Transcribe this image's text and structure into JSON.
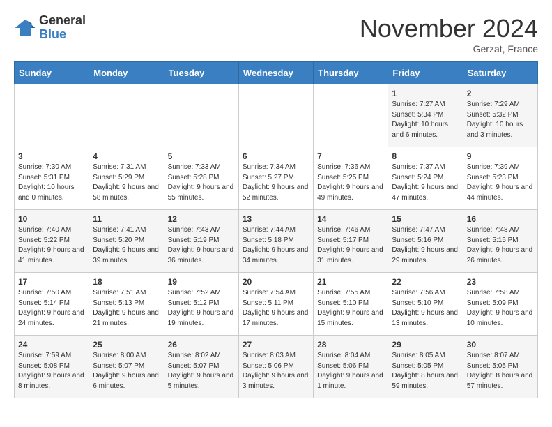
{
  "logo": {
    "general": "General",
    "blue": "Blue"
  },
  "title": "November 2024",
  "location": "Gerzat, France",
  "days_header": [
    "Sunday",
    "Monday",
    "Tuesday",
    "Wednesday",
    "Thursday",
    "Friday",
    "Saturday"
  ],
  "weeks": [
    [
      {
        "day": "",
        "info": ""
      },
      {
        "day": "",
        "info": ""
      },
      {
        "day": "",
        "info": ""
      },
      {
        "day": "",
        "info": ""
      },
      {
        "day": "",
        "info": ""
      },
      {
        "day": "1",
        "info": "Sunrise: 7:27 AM\nSunset: 5:34 PM\nDaylight: 10 hours and 6 minutes."
      },
      {
        "day": "2",
        "info": "Sunrise: 7:29 AM\nSunset: 5:32 PM\nDaylight: 10 hours and 3 minutes."
      }
    ],
    [
      {
        "day": "3",
        "info": "Sunrise: 7:30 AM\nSunset: 5:31 PM\nDaylight: 10 hours and 0 minutes."
      },
      {
        "day": "4",
        "info": "Sunrise: 7:31 AM\nSunset: 5:29 PM\nDaylight: 9 hours and 58 minutes."
      },
      {
        "day": "5",
        "info": "Sunrise: 7:33 AM\nSunset: 5:28 PM\nDaylight: 9 hours and 55 minutes."
      },
      {
        "day": "6",
        "info": "Sunrise: 7:34 AM\nSunset: 5:27 PM\nDaylight: 9 hours and 52 minutes."
      },
      {
        "day": "7",
        "info": "Sunrise: 7:36 AM\nSunset: 5:25 PM\nDaylight: 9 hours and 49 minutes."
      },
      {
        "day": "8",
        "info": "Sunrise: 7:37 AM\nSunset: 5:24 PM\nDaylight: 9 hours and 47 minutes."
      },
      {
        "day": "9",
        "info": "Sunrise: 7:39 AM\nSunset: 5:23 PM\nDaylight: 9 hours and 44 minutes."
      }
    ],
    [
      {
        "day": "10",
        "info": "Sunrise: 7:40 AM\nSunset: 5:22 PM\nDaylight: 9 hours and 41 minutes."
      },
      {
        "day": "11",
        "info": "Sunrise: 7:41 AM\nSunset: 5:20 PM\nDaylight: 9 hours and 39 minutes."
      },
      {
        "day": "12",
        "info": "Sunrise: 7:43 AM\nSunset: 5:19 PM\nDaylight: 9 hours and 36 minutes."
      },
      {
        "day": "13",
        "info": "Sunrise: 7:44 AM\nSunset: 5:18 PM\nDaylight: 9 hours and 34 minutes."
      },
      {
        "day": "14",
        "info": "Sunrise: 7:46 AM\nSunset: 5:17 PM\nDaylight: 9 hours and 31 minutes."
      },
      {
        "day": "15",
        "info": "Sunrise: 7:47 AM\nSunset: 5:16 PM\nDaylight: 9 hours and 29 minutes."
      },
      {
        "day": "16",
        "info": "Sunrise: 7:48 AM\nSunset: 5:15 PM\nDaylight: 9 hours and 26 minutes."
      }
    ],
    [
      {
        "day": "17",
        "info": "Sunrise: 7:50 AM\nSunset: 5:14 PM\nDaylight: 9 hours and 24 minutes."
      },
      {
        "day": "18",
        "info": "Sunrise: 7:51 AM\nSunset: 5:13 PM\nDaylight: 9 hours and 21 minutes."
      },
      {
        "day": "19",
        "info": "Sunrise: 7:52 AM\nSunset: 5:12 PM\nDaylight: 9 hours and 19 minutes."
      },
      {
        "day": "20",
        "info": "Sunrise: 7:54 AM\nSunset: 5:11 PM\nDaylight: 9 hours and 17 minutes."
      },
      {
        "day": "21",
        "info": "Sunrise: 7:55 AM\nSunset: 5:10 PM\nDaylight: 9 hours and 15 minutes."
      },
      {
        "day": "22",
        "info": "Sunrise: 7:56 AM\nSunset: 5:10 PM\nDaylight: 9 hours and 13 minutes."
      },
      {
        "day": "23",
        "info": "Sunrise: 7:58 AM\nSunset: 5:09 PM\nDaylight: 9 hours and 10 minutes."
      }
    ],
    [
      {
        "day": "24",
        "info": "Sunrise: 7:59 AM\nSunset: 5:08 PM\nDaylight: 9 hours and 8 minutes."
      },
      {
        "day": "25",
        "info": "Sunrise: 8:00 AM\nSunset: 5:07 PM\nDaylight: 9 hours and 6 minutes."
      },
      {
        "day": "26",
        "info": "Sunrise: 8:02 AM\nSunset: 5:07 PM\nDaylight: 9 hours and 5 minutes."
      },
      {
        "day": "27",
        "info": "Sunrise: 8:03 AM\nSunset: 5:06 PM\nDaylight: 9 hours and 3 minutes."
      },
      {
        "day": "28",
        "info": "Sunrise: 8:04 AM\nSunset: 5:06 PM\nDaylight: 9 hours and 1 minute."
      },
      {
        "day": "29",
        "info": "Sunrise: 8:05 AM\nSunset: 5:05 PM\nDaylight: 8 hours and 59 minutes."
      },
      {
        "day": "30",
        "info": "Sunrise: 8:07 AM\nSunset: 5:05 PM\nDaylight: 8 hours and 57 minutes."
      }
    ]
  ]
}
